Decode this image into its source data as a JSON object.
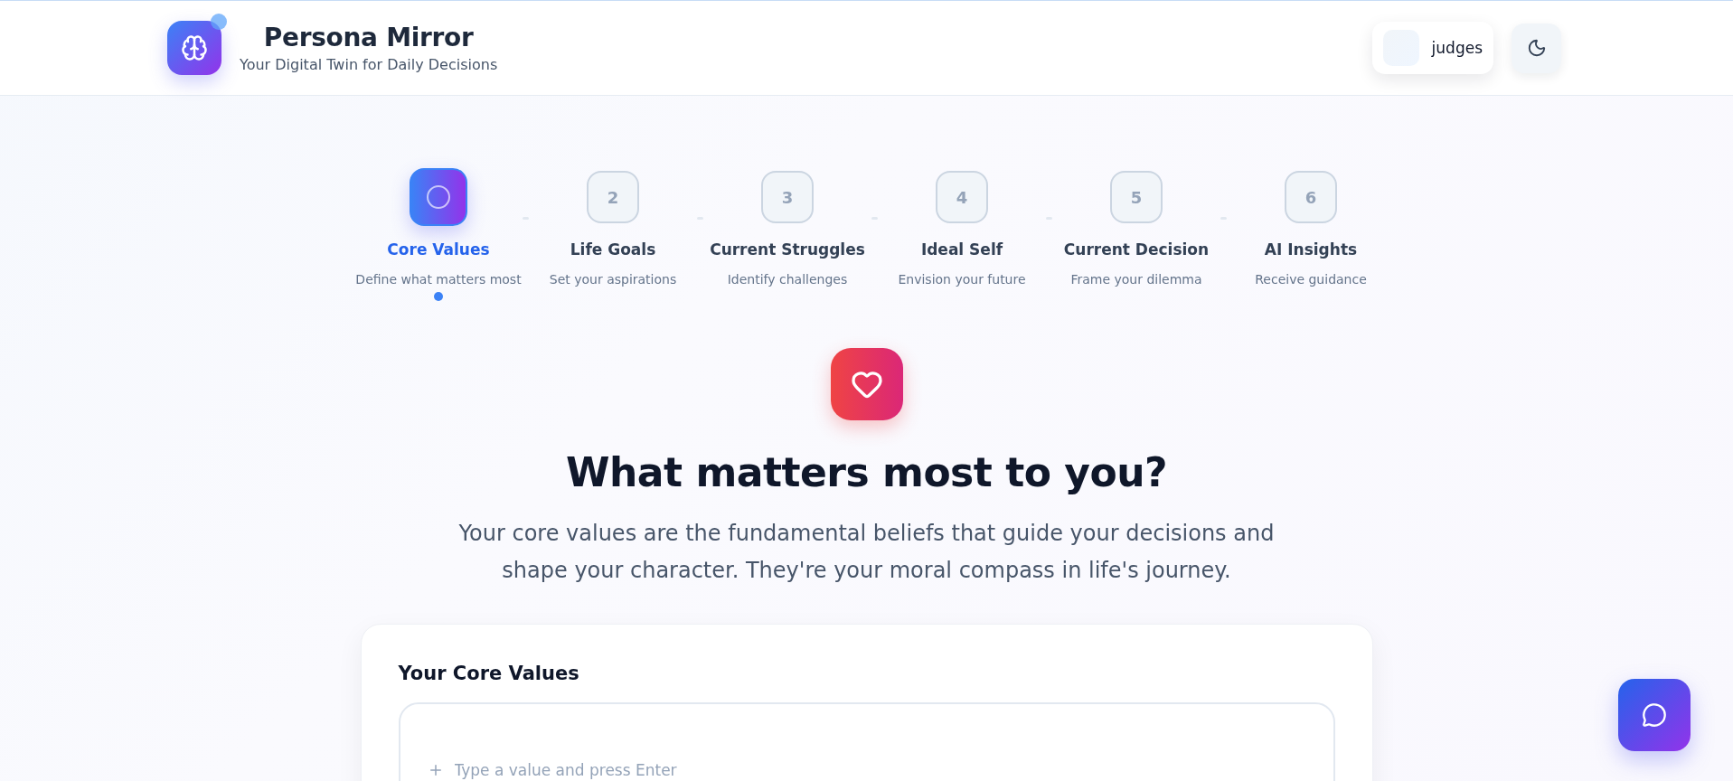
{
  "header": {
    "title": "Persona Mirror",
    "subtitle": "Your Digital Twin for Daily Decisions",
    "user": {
      "name": "judges"
    }
  },
  "steps": [
    {
      "label": "Core Values",
      "description": "Define what matters most",
      "selected": true
    },
    {
      "number": "2",
      "label": "Life Goals",
      "description": "Set your aspirations",
      "selected": false
    },
    {
      "number": "3",
      "label": "Current Struggles",
      "description": "Identify challenges",
      "selected": false
    },
    {
      "number": "4",
      "label": "Ideal Self",
      "description": "Envision your future",
      "selected": false
    },
    {
      "number": "5",
      "label": "Current Decision",
      "description": "Frame your dilemma",
      "selected": false
    },
    {
      "number": "6",
      "label": "AI Insights",
      "description": "Receive guidance",
      "selected": false
    }
  ],
  "hero": {
    "heading": "What matters most to you?",
    "text": "Your core values are the fundamental beliefs that guide your decisions and shape your character. They're your moral compass in life's journey."
  },
  "card": {
    "title": "Your Core Values",
    "input": {
      "placeholder": "Type a value and press Enter"
    }
  }
}
